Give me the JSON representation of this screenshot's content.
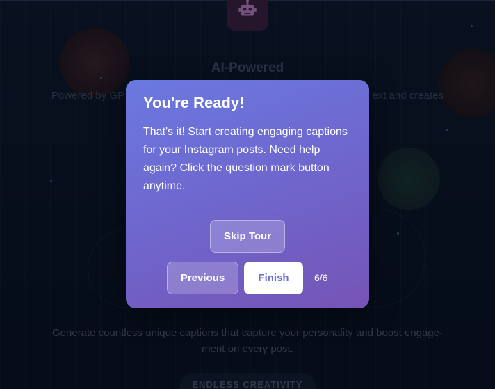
{
  "background": {
    "feature_title": "AI-Powered",
    "feature_text_left": "Powered by GP",
    "feature_text_right": "ext and creates",
    "description": "Generate countless unique captions that capture your personality and boost engage-ment on every post.",
    "pill_label": "ENDLESS CREATIVITY",
    "icon": "robot-icon"
  },
  "tour": {
    "title": "You're Ready!",
    "body": "That's it! Start creating engaging captions for your Instagram posts. Need help again? Click the question mark button anytime.",
    "skip_label": "Skip Tour",
    "previous_label": "Previous",
    "finish_label": "Finish",
    "step_counter": "6/6"
  },
  "colors": {
    "modal_gradient_start": "#6b79e0",
    "modal_gradient_end": "#7654b6",
    "finish_text": "#6a72d6",
    "page_background": "#0b1424"
  }
}
